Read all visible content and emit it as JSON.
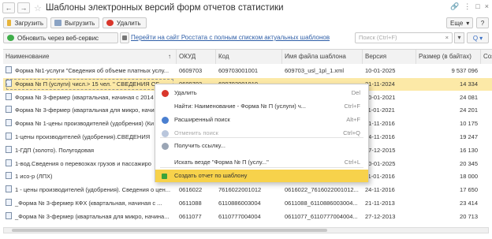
{
  "window": {
    "title": "Шаблоны электронных версий форм отчетов статистики",
    "back_label": "←",
    "forward_label": "→",
    "star_label": "☆",
    "right_controls": [
      "🔗",
      "⋮",
      "□",
      "×"
    ]
  },
  "toolbar": {
    "load_label": "Загрузить",
    "unload_label": "Выгрузить",
    "delete_label": "Удалить",
    "more_label": "Еще",
    "more_chevron": "▾",
    "help_label": "?"
  },
  "toolbar2": {
    "update_label": "Обновить через веб-сервис",
    "link_label": "Перейти на сайт Росстата с полным списком актуальных шаблонов",
    "search_placeholder": "Поиск (Ctrl+F)",
    "search_clear": "×",
    "search_button_label": "Q",
    "search_button_chevron": "▾"
  },
  "table": {
    "columns": [
      "Наименование",
      "ОКУД",
      "Код",
      "Имя файла шаблона",
      "Версия",
      "Размер (в байтах)",
      "Создать"
    ],
    "sort_indicator": "↑",
    "rows": [
      {
        "name": "Форма №1-услуги \"Сведения об объеме платных услу...",
        "okud": "0609703",
        "code": "609703001001",
        "file": "609703_usl_1pl_1.xml",
        "version": "10-01-2025",
        "size": "9 537 096",
        "selected": false
      },
      {
        "name": "Форма № П (услуги) числ.> 15 чел. \" СВЕДЕНИЯ ОБ ...",
        "okud": "0609703",
        "code": "609703001010",
        "file": "",
        "version": "21-11-2024",
        "size": "14 334",
        "selected": true
      },
      {
        "name": "Форма № 3-фермер (квартальная, начиная с 2014",
        "okud": "",
        "code": "",
        "file": "",
        "version": "10-01-2021",
        "size": "24 081",
        "selected": false
      },
      {
        "name": "Форма № 3-фермер (квартальная для микро, начи",
        "okud": "",
        "code": "",
        "file": "",
        "version": "11-01-2021",
        "size": "24 201",
        "selected": false
      },
      {
        "name": "Форма № 1-цены производителей (удобрения) (Ки",
        "okud": "",
        "code": "",
        "file": "",
        "version": "21-11-2016",
        "size": "10 175",
        "selected": false
      },
      {
        "name": "1-цены производителей (удобрения).СВЕДЕНИЯ",
        "okud": "",
        "code": "",
        "file": "",
        "version": "24-11-2016",
        "size": "19 247",
        "selected": false
      },
      {
        "name": "1-ГДП (золото). Полугодовая",
        "okud": "",
        "code": "",
        "file": "",
        "version": "17-12-2015",
        "size": "16 130",
        "selected": false
      },
      {
        "name": "1-вод.Сведения о перевозках грузов и пассажиро",
        "okud": "",
        "code": "",
        "file": "",
        "version": "10-01-2025",
        "size": "20 345",
        "selected": false
      },
      {
        "name": "1 исо-р (ЛПХ)",
        "okud": "",
        "code": "",
        "file": "",
        "version": "11-01-2016",
        "size": "18 000",
        "selected": false
      },
      {
        "name": "1 - цены производителей (удобрения). Сведения о цен...",
        "okud": "0616022",
        "code": "7616022001012",
        "file": "0616022_7616022001012...",
        "version": "24-11-2016",
        "size": "17 650",
        "selected": false
      },
      {
        "name": "_Форма № 3-фермер КФХ (квартальная, начиная с ...",
        "okud": "0611088",
        "code": "6110886003004",
        "file": "0611088_6110886003004...",
        "version": "21-11-2013",
        "size": "23 414",
        "selected": false
      },
      {
        "name": "_Форма № 3-фермер (квартальная для микро, начина...",
        "okud": "0611077",
        "code": "6110777004004",
        "file": "0611077_6110777004004...",
        "version": "27-12-2013",
        "size": "20 713",
        "selected": false
      }
    ]
  },
  "context_menu": {
    "items": [
      {
        "label": "Удалить",
        "shortcut": "Del",
        "icon": "delete-icon",
        "disabled": false,
        "highlighted": false
      },
      {
        "label": "Найти: Наименование - Форма № П (услуги) ч...",
        "shortcut": "Ctrl+F",
        "icon": "",
        "disabled": false,
        "highlighted": false
      },
      {
        "label": "Расширенный поиск",
        "shortcut": "Alt+F",
        "icon": "advanced-search-icon",
        "disabled": false,
        "highlighted": false
      },
      {
        "label": "Отменить поиск",
        "shortcut": "Ctrl+Q",
        "icon": "cancel-search-icon",
        "disabled": true,
        "highlighted": false
      },
      {
        "label": "Получить ссылку...",
        "shortcut": "",
        "icon": "link-icon",
        "disabled": false,
        "highlighted": false
      },
      {
        "label": "Искать везде \"Форма № П (услу...\"",
        "shortcut": "Ctrl+L",
        "icon": "",
        "disabled": false,
        "highlighted": false
      },
      {
        "label": "Создать отчет по шаблону",
        "shortcut": "",
        "icon": "plus-icon",
        "disabled": false,
        "highlighted": true
      }
    ]
  },
  "colors": {
    "selected_row": "#fce9a7",
    "highlight": "#f7d24b",
    "link": "#2f5fa8",
    "delete_red": "#d9362b",
    "plus_green": "#3aa33a"
  }
}
